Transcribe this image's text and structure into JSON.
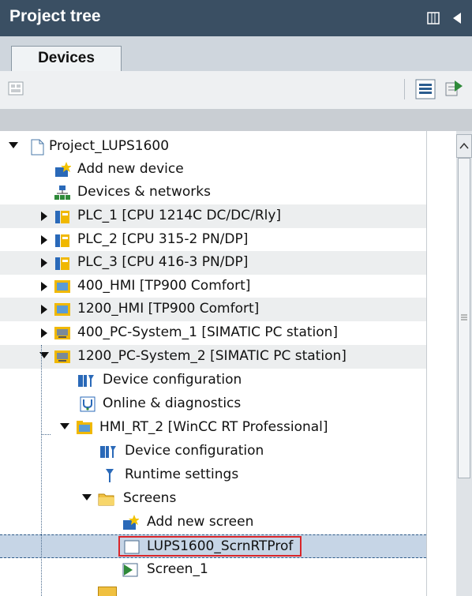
{
  "panel": {
    "title": "Project tree"
  },
  "tabs": [
    {
      "label": "Devices"
    }
  ],
  "tree": {
    "items": [
      {
        "label": "Project_LUPS1600",
        "icon": "project-icon"
      },
      {
        "label": "Add new device",
        "icon": "add-device-icon"
      },
      {
        "label": "Devices & networks",
        "icon": "network-icon"
      },
      {
        "label": "PLC_1 [CPU 1214C DC/DC/Rly]",
        "icon": "plc-icon"
      },
      {
        "label": "PLC_2 [CPU 315-2 PN/DP]",
        "icon": "plc-icon"
      },
      {
        "label": "PLC_3 [CPU 416-3 PN/DP]",
        "icon": "plc-icon"
      },
      {
        "label": "400_HMI [TP900 Comfort]",
        "icon": "hmi-icon"
      },
      {
        "label": "1200_HMI [TP900 Comfort]",
        "icon": "hmi-icon"
      },
      {
        "label": "400_PC-System_1 [SIMATIC PC station]",
        "icon": "pc-station-icon"
      },
      {
        "label": "1200_PC-System_2 [SIMATIC PC station]",
        "icon": "pc-station-icon"
      },
      {
        "label": "Device configuration",
        "icon": "device-config-icon"
      },
      {
        "label": "Online & diagnostics",
        "icon": "diagnostics-icon"
      },
      {
        "label": "HMI_RT_2 [WinCC RT Professional]",
        "icon": "hmi-runtime-folder-icon"
      },
      {
        "label": "Device configuration",
        "icon": "device-config-icon"
      },
      {
        "label": "Runtime settings",
        "icon": "runtime-settings-icon"
      },
      {
        "label": "Screens",
        "icon": "folder-icon"
      },
      {
        "label": "Add new screen",
        "icon": "add-screen-icon"
      },
      {
        "label": "LUPS1600_ScrnRTProf",
        "icon": "screen-icon"
      },
      {
        "label": "Screen_1",
        "icon": "screen-start-icon"
      }
    ]
  },
  "colors": {
    "titlebar": "#3a4f63",
    "selection": "#c6d5e6",
    "highlight_box": "#d9262a"
  }
}
